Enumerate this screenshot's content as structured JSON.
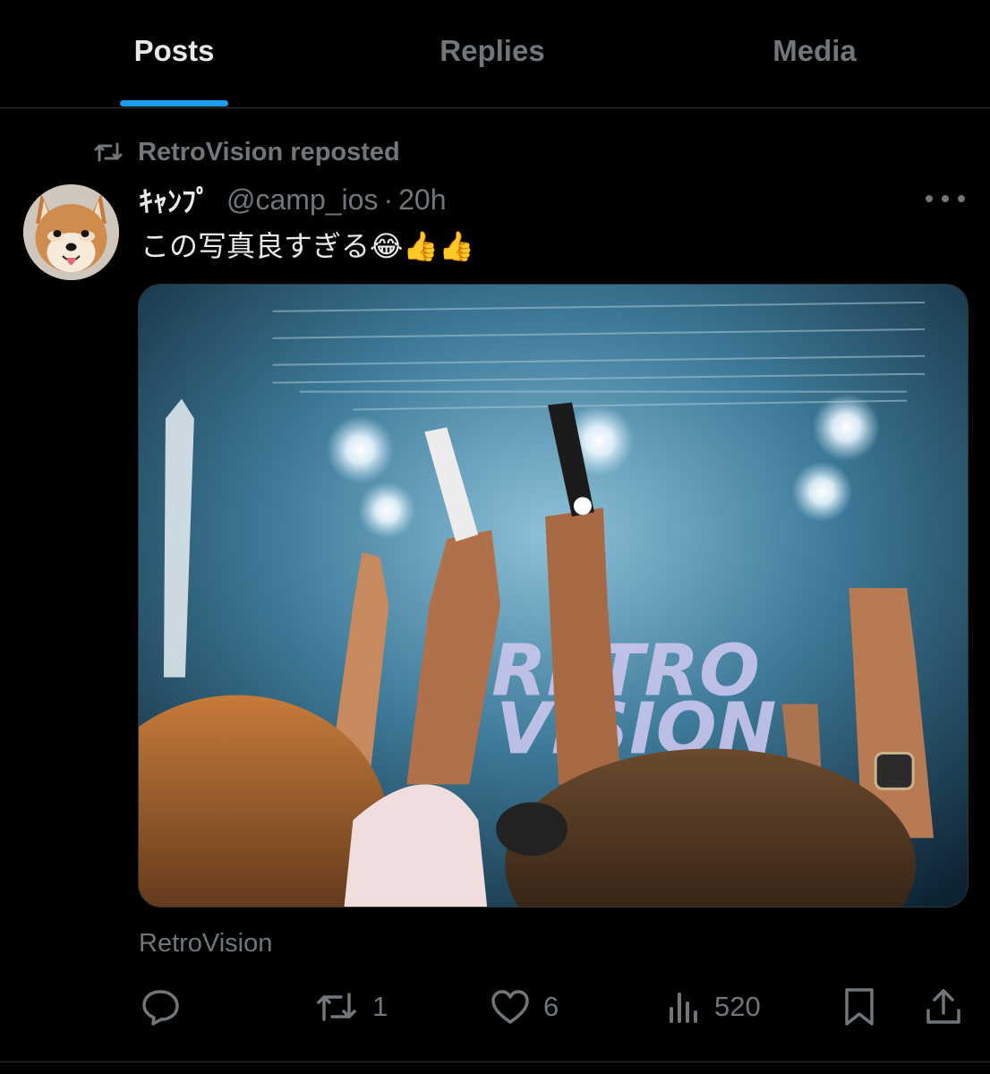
{
  "tabs": [
    {
      "label": "Posts",
      "active": true
    },
    {
      "label": "Replies",
      "active": false
    },
    {
      "label": "Media",
      "active": false
    }
  ],
  "repost": {
    "icon": "repost-icon",
    "text": "RetroVision reposted"
  },
  "post": {
    "display_name": "ｷｬﾝﾌﾟ",
    "handle": "@camp_ios",
    "separator": "·",
    "time": "20h",
    "text": "この写真良すぎる😂👍👍",
    "media_text": "RETRO VISION",
    "source_label": "RetroVision"
  },
  "actions": {
    "reply": {
      "icon": "reply-icon",
      "count": ""
    },
    "repost": {
      "icon": "repost-icon",
      "count": "1"
    },
    "like": {
      "icon": "heart-icon",
      "count": "6"
    },
    "views": {
      "icon": "views-icon",
      "count": "520"
    },
    "bookmark": {
      "icon": "bookmark-icon"
    },
    "share": {
      "icon": "share-icon"
    }
  },
  "colors": {
    "background": "#000000",
    "primary_text": "#e7e9ea",
    "secondary_text": "#71767b",
    "accent": "#1d9bf0",
    "divider": "#2f3336"
  }
}
